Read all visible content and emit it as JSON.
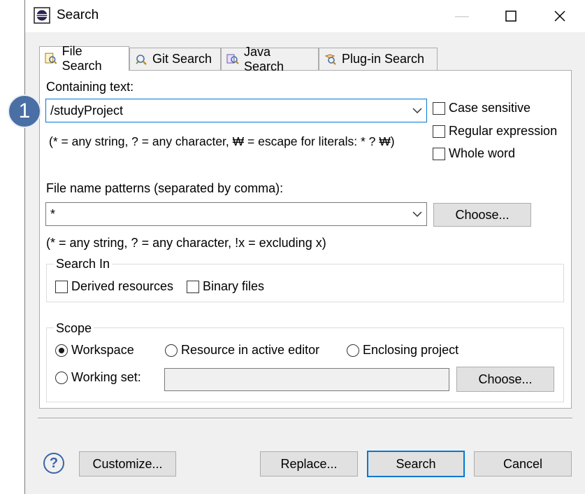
{
  "window": {
    "title": "Search",
    "min_glyph": "—",
    "max_glyph": "☐",
    "close_glyph": "✕"
  },
  "badge": {
    "number": "1"
  },
  "tabs": [
    {
      "label": "File Search",
      "icon": "file-search-icon",
      "active": true
    },
    {
      "label": "Git Search",
      "icon": "git-search-icon"
    },
    {
      "label": "Java Search",
      "icon": "java-search-icon"
    },
    {
      "label": "Plug-in Search",
      "icon": "plugin-search-icon"
    }
  ],
  "containing": {
    "label": "Containing text:",
    "value": "/studyProject",
    "hint": "(* = any string, ? = any character, ₩ = escape for literals: * ? ₩)"
  },
  "options": {
    "case_sensitive": "Case sensitive",
    "regular_expression": "Regular expression",
    "whole_word": "Whole word"
  },
  "patterns": {
    "label": "File name patterns (separated by comma):",
    "value": "*",
    "choose": "Choose...",
    "hint": "(* = any string, ? = any character, !x = excluding x)"
  },
  "search_in": {
    "title": "Search In",
    "derived": "Derived resources",
    "binary": "Binary files"
  },
  "scope": {
    "title": "Scope",
    "workspace": "Workspace",
    "active_editor": "Resource in active editor",
    "enclosing": "Enclosing project",
    "working_set": "Working set:",
    "choose": "Choose...",
    "selected": "workspace"
  },
  "footer": {
    "help": "?",
    "customize": "Customize...",
    "replace": "Replace...",
    "search": "Search",
    "cancel": "Cancel"
  },
  "colors": {
    "accent": "#0078d7",
    "badge": "#4a6fa5"
  }
}
